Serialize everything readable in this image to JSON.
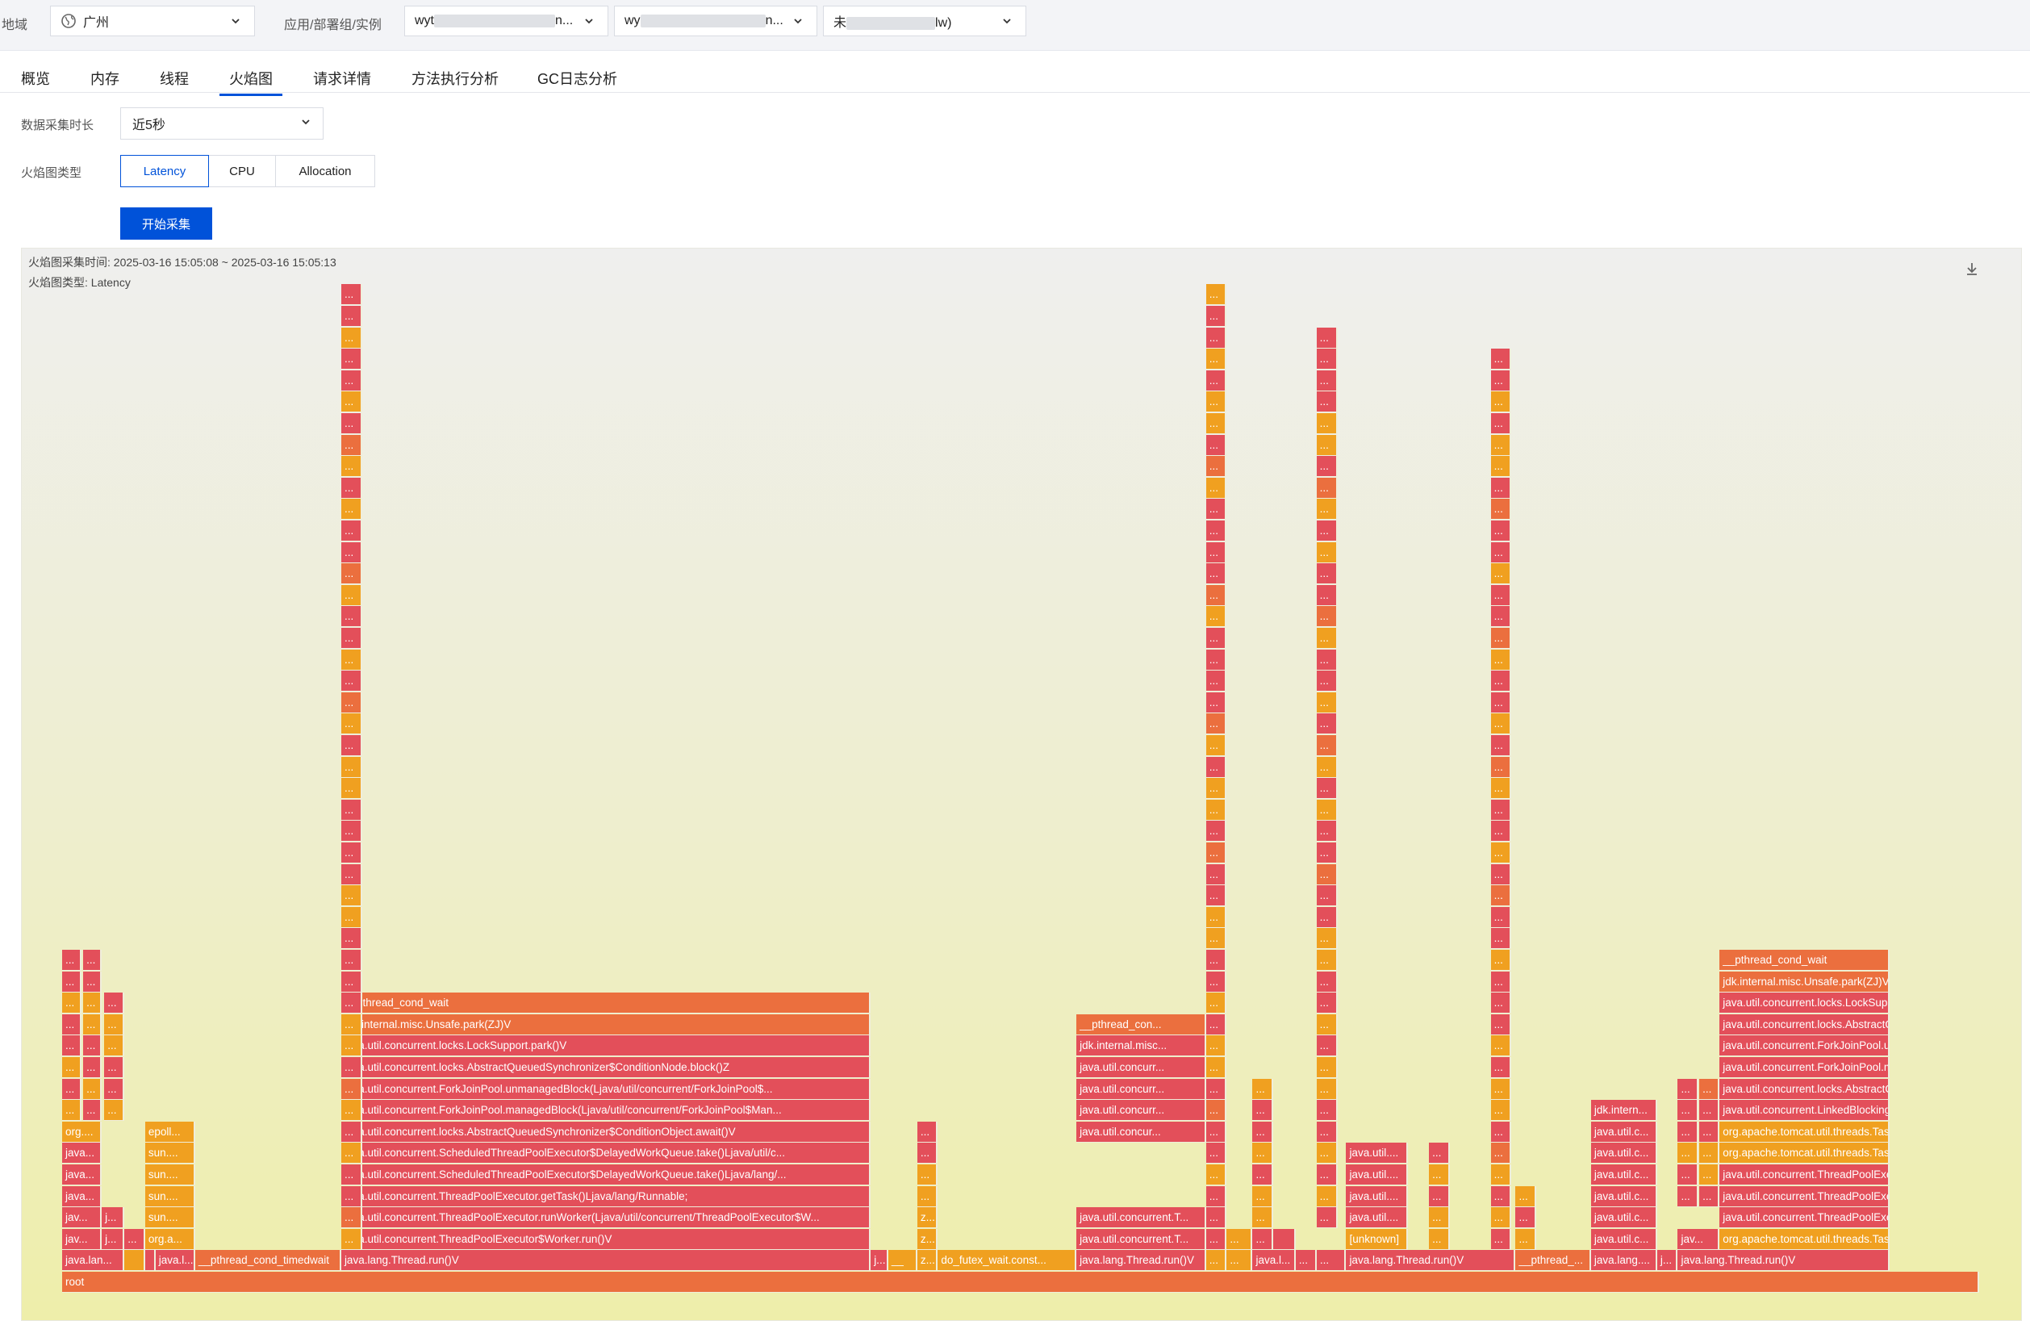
{
  "topbar": {
    "region_label": "地域",
    "region_value": "广州",
    "app_label": "应用/部署组/实例",
    "app_value_prefix": "wyt",
    "app_value_suffix": "n...",
    "group_value_prefix": "wy",
    "group_value_suffix": "n...",
    "instance_value_prefix": "未",
    "instance_value_suffix": "lw)"
  },
  "tabs": [
    "概览",
    "内存",
    "线程",
    "火焰图",
    "请求详情",
    "方法执行分析",
    "GC日志分析"
  ],
  "active_tab": "火焰图",
  "form": {
    "duration_label": "数据采集时长",
    "duration_value": "近5秒",
    "type_label": "火焰图类型",
    "type_options": [
      "Latency",
      "CPU",
      "Allocation"
    ],
    "type_selected": "Latency",
    "start_button": "开始采集"
  },
  "flamegraph": {
    "time_label": "火焰图采集时间:",
    "time_range": "2025-03-16 15:05:08 ~ 2025-03-16 15:05:13",
    "type_label": "火焰图类型:",
    "type_value": "Latency",
    "root": "root",
    "colors": {
      "red": "#e34f5a",
      "orange": "#eb6f3e",
      "amber": "#f0a020"
    },
    "frames": [
      {
        "label": "root",
        "c": "orange",
        "d": 0,
        "s": 0,
        "e": 1.0
      },
      {
        "label": "java.lan...",
        "c": "red",
        "d": 1,
        "s": 0.0,
        "e": 0.0325
      },
      {
        "label": "",
        "c": "amber",
        "d": 1,
        "s": 0.0325,
        "e": 0.0433
      },
      {
        "label": "",
        "c": "red",
        "d": 1,
        "s": 0.0433,
        "e": 0.0487
      },
      {
        "label": "java.l...",
        "c": "red",
        "d": 1,
        "s": 0.0487,
        "e": 0.0694
      },
      {
        "label": "__pthread_cond_timedwait",
        "c": "orange",
        "d": 1,
        "s": 0.0694,
        "e": 0.1456
      },
      {
        "label": "java.lang.Thread.run()V",
        "c": "red",
        "d": 1,
        "s": 0.1456,
        "e": 0.4218
      },
      {
        "label": "j...",
        "c": "red",
        "d": 1,
        "s": 0.4218,
        "e": 0.4309
      },
      {
        "label": "__",
        "c": "amber",
        "d": 1,
        "s": 0.4309,
        "e": 0.4461
      },
      {
        "label": "z...",
        "c": "amber",
        "d": 1,
        "s": 0.4461,
        "e": 0.4568
      },
      {
        "label": "do_futex_wait.const...",
        "c": "amber",
        "d": 1,
        "s": 0.4568,
        "e": 0.5291
      },
      {
        "label": "java.lang.Thread.run()V",
        "c": "red",
        "d": 1,
        "s": 0.5291,
        "e": 0.5967
      },
      {
        "label": "...",
        "c": "amber",
        "d": 1,
        "s": 0.5967,
        "e": 0.6075
      },
      {
        "label": "...",
        "c": "amber",
        "d": 1,
        "s": 0.6075,
        "e": 0.621
      },
      {
        "label": "java.l...",
        "c": "red",
        "d": 1,
        "s": 0.621,
        "e": 0.6434
      },
      {
        "label": "...",
        "c": "red",
        "d": 1,
        "s": 0.6434,
        "e": 0.6544
      },
      {
        "label": "...",
        "c": "red",
        "d": 1,
        "s": 0.6544,
        "e": 0.6698
      },
      {
        "label": "java.lang.Thread.run()V",
        "c": "red",
        "d": 1,
        "s": 0.6698,
        "e": 0.7582
      },
      {
        "label": "__pthread_...",
        "c": "orange",
        "d": 1,
        "s": 0.7582,
        "e": 0.7975
      },
      {
        "label": "java.lang....",
        "c": "red",
        "d": 1,
        "s": 0.7975,
        "e": 0.832
      },
      {
        "label": "j...",
        "c": "red",
        "d": 1,
        "s": 0.832,
        "e": 0.8428
      },
      {
        "label": "java.lang.Thread.run()V",
        "c": "red",
        "d": 1,
        "s": 0.8428,
        "e": 0.9531
      },
      {
        "label": "jav...",
        "c": "red",
        "d": 2,
        "s": 0.0,
        "e": 0.0207
      },
      {
        "label": "j...",
        "c": "red",
        "d": 2,
        "s": 0.0207,
        "e": 0.0325
      },
      {
        "label": "...",
        "c": "red",
        "d": 2,
        "s": 0.0325,
        "e": 0.0433
      },
      {
        "label": "org.a...",
        "c": "amber",
        "d": 2,
        "s": 0.0433,
        "e": 0.0694
      },
      {
        "label": "java.util.concurrent.ThreadPoolExecutor$Worker.run()V",
        "c": "red",
        "d": 2,
        "s": 0.1456,
        "e": 0.4218
      },
      {
        "label": "z...",
        "c": "amber",
        "d": 2,
        "s": 0.4461,
        "e": 0.4568
      },
      {
        "label": "java.util.concurrent.T...",
        "c": "red",
        "d": 2,
        "s": 0.5291,
        "e": 0.5967
      },
      {
        "label": "...",
        "c": "red",
        "d": 2,
        "s": 0.5967,
        "e": 0.6075
      },
      {
        "label": "...",
        "c": "amber",
        "d": 2,
        "s": 0.6075,
        "e": 0.621
      },
      {
        "label": "...",
        "c": "red",
        "d": 2,
        "s": 0.621,
        "e": 0.6434
      },
      {
        "label": "[unknown]",
        "c": "amber",
        "d": 2,
        "s": 0.6698,
        "e": 0.7022
      },
      {
        "label": "java.util.c...",
        "c": "red",
        "d": 2,
        "s": 0.7975,
        "e": 0.832
      },
      {
        "label": "jav...",
        "c": "red",
        "d": 2,
        "s": 0.8428,
        "e": 0.8646
      },
      {
        "label": "org.apache.tomcat.util.threads.Task...",
        "c": "amber",
        "d": 2,
        "s": 0.8646,
        "e": 0.9531
      },
      {
        "label": "jav...",
        "c": "red",
        "d": 3,
        "s": 0.0,
        "e": 0.0207
      },
      {
        "label": "j...",
        "c": "red",
        "d": 3,
        "s": 0.0207,
        "e": 0.0325
      },
      {
        "label": "sun....",
        "c": "amber",
        "d": 3,
        "s": 0.0433,
        "e": 0.0694
      },
      {
        "label": "java.util.concurrent.ThreadPoolExecutor.runWorker(Ljava/util/concurrent/ThreadPoolExecutor$W...",
        "c": "red",
        "d": 3,
        "s": 0.1456,
        "e": 0.4218
      },
      {
        "label": "z...",
        "c": "amber",
        "d": 3,
        "s": 0.4461,
        "e": 0.4568
      },
      {
        "label": "java.util.concurrent.T...",
        "c": "red",
        "d": 3,
        "s": 0.5291,
        "e": 0.5967
      },
      {
        "label": "java.util....",
        "c": "red",
        "d": 3,
        "s": 0.6698,
        "e": 0.7022
      },
      {
        "label": "java.util.c...",
        "c": "red",
        "d": 3,
        "s": 0.7975,
        "e": 0.832
      },
      {
        "label": "java.util.concurrent.ThreadPoolExe...",
        "c": "red",
        "d": 3,
        "s": 0.8646,
        "e": 0.9531
      },
      {
        "label": "java...",
        "c": "red",
        "d": 4,
        "s": 0.0,
        "e": 0.0207
      },
      {
        "label": "sun....",
        "c": "amber",
        "d": 4,
        "s": 0.0433,
        "e": 0.0694
      },
      {
        "label": "java.util.concurrent.ThreadPoolExecutor.getTask()Ljava/lang/Runnable;",
        "c": "red",
        "d": 4,
        "s": 0.1456,
        "e": 0.4218
      },
      {
        "label": "java.util....",
        "c": "red",
        "d": 4,
        "s": 0.6698,
        "e": 0.7022
      },
      {
        "label": "java.util.c...",
        "c": "red",
        "d": 4,
        "s": 0.7975,
        "e": 0.832
      },
      {
        "label": "java.util.concurrent.ThreadPoolExec...",
        "c": "red",
        "d": 4,
        "s": 0.8646,
        "e": 0.9531
      },
      {
        "label": "java...",
        "c": "red",
        "d": 5,
        "s": 0.0,
        "e": 0.0207
      },
      {
        "label": "sun....",
        "c": "amber",
        "d": 5,
        "s": 0.0433,
        "e": 0.0694
      },
      {
        "label": "java.util.concurrent.ScheduledThreadPoolExecutor$DelayedWorkQueue.take()Ljava/lang/...",
        "c": "red",
        "d": 5,
        "s": 0.1456,
        "e": 0.4218
      },
      {
        "label": "java.util....",
        "c": "red",
        "d": 5,
        "s": 0.6698,
        "e": 0.7022
      },
      {
        "label": "java.util.c...",
        "c": "red",
        "d": 5,
        "s": 0.7975,
        "e": 0.832
      },
      {
        "label": "java.util.concurrent.ThreadPoolExec...",
        "c": "red",
        "d": 5,
        "s": 0.8646,
        "e": 0.9531
      },
      {
        "label": "java...",
        "c": "red",
        "d": 6,
        "s": 0.0,
        "e": 0.0207
      },
      {
        "label": "sun....",
        "c": "amber",
        "d": 6,
        "s": 0.0433,
        "e": 0.0694
      },
      {
        "label": "java.util.concurrent.ScheduledThreadPoolExecutor$DelayedWorkQueue.take()Ljava/util/c...",
        "c": "red",
        "d": 6,
        "s": 0.1456,
        "e": 0.4218
      },
      {
        "label": "java.util....",
        "c": "red",
        "d": 6,
        "s": 0.6698,
        "e": 0.7022
      },
      {
        "label": "java.util.c...",
        "c": "red",
        "d": 6,
        "s": 0.7975,
        "e": 0.832
      },
      {
        "label": "org.apache.tomcat.util.threads.Task...",
        "c": "amber",
        "d": 6,
        "s": 0.8646,
        "e": 0.9531
      },
      {
        "label": "org....",
        "c": "amber",
        "d": 7,
        "s": 0.0,
        "e": 0.0207
      },
      {
        "label": "epoll...",
        "c": "amber",
        "d": 7,
        "s": 0.0433,
        "e": 0.0694
      },
      {
        "label": "java.util.concurrent.locks.AbstractQueuedSynchronizer$ConditionObject.await()V",
        "c": "red",
        "d": 7,
        "s": 0.1456,
        "e": 0.4218
      },
      {
        "label": "java.util.concur...",
        "c": "red",
        "d": 7,
        "s": 0.5291,
        "e": 0.5967
      },
      {
        "label": "java.util.c...",
        "c": "red",
        "d": 7,
        "s": 0.7975,
        "e": 0.832
      },
      {
        "label": "org.apache.tomcat.util.threads.Tas...",
        "c": "amber",
        "d": 7,
        "s": 0.8646,
        "e": 0.9531
      },
      {
        "label": "java.util.concurrent.ForkJoinPool.managedBlock(Ljava/util/concurrent/ForkJoinPool$Man...",
        "c": "red",
        "d": 8,
        "s": 0.1456,
        "e": 0.4218
      },
      {
        "label": "java.util.concurr...",
        "c": "red",
        "d": 8,
        "s": 0.5291,
        "e": 0.5967
      },
      {
        "label": "jdk.intern...",
        "c": "red",
        "d": 8,
        "s": 0.7975,
        "e": 0.832
      },
      {
        "label": "java.util.concurrent.LinkedBlockingQ...",
        "c": "red",
        "d": 8,
        "s": 0.8646,
        "e": 0.9531
      },
      {
        "label": "java.util.concurrent.ForkJoinPool.unmanagedBlock(Ljava/util/concurrent/ForkJoinPool$...",
        "c": "red",
        "d": 9,
        "s": 0.1456,
        "e": 0.4218
      },
      {
        "label": "java.util.concurr...",
        "c": "red",
        "d": 9,
        "s": 0.5291,
        "e": 0.5967
      },
      {
        "label": "java.util.concurrent.locks.AbstractQ...",
        "c": "red",
        "d": 9,
        "s": 0.8646,
        "e": 0.9531
      },
      {
        "label": "java.util.concurrent.locks.AbstractQueuedSynchronizer$ConditionNode.block()Z",
        "c": "red",
        "d": 10,
        "s": 0.1456,
        "e": 0.4218
      },
      {
        "label": "java.util.concurr...",
        "c": "red",
        "d": 10,
        "s": 0.5291,
        "e": 0.5967
      },
      {
        "label": "java.util.concurrent.ForkJoinPool.m...",
        "c": "red",
        "d": 10,
        "s": 0.8646,
        "e": 0.9531
      },
      {
        "label": "java.util.concurrent.locks.LockSupport.park()V",
        "c": "red",
        "d": 11,
        "s": 0.1456,
        "e": 0.4218
      },
      {
        "label": "jdk.internal.misc...",
        "c": "red",
        "d": 11,
        "s": 0.5291,
        "e": 0.5967
      },
      {
        "label": "java.util.concurrent.ForkJoinPool.u...",
        "c": "red",
        "d": 11,
        "s": 0.8646,
        "e": 0.9531
      },
      {
        "label": "jdk.internal.misc.Unsafe.park(ZJ)V",
        "c": "orange",
        "d": 12,
        "s": 0.1456,
        "e": 0.4218
      },
      {
        "label": "__pthread_con...",
        "c": "orange",
        "d": 12,
        "s": 0.5291,
        "e": 0.5967
      },
      {
        "label": "java.util.concurrent.locks.AbstractQ...",
        "c": "red",
        "d": 12,
        "s": 0.8646,
        "e": 0.9531
      },
      {
        "label": "__pthread_cond_wait",
        "c": "orange",
        "d": 13,
        "s": 0.1456,
        "e": 0.4218
      },
      {
        "label": "java.util.concurrent.locks.LockSupp...",
        "c": "red",
        "d": 13,
        "s": 0.8646,
        "e": 0.9531
      },
      {
        "label": "jdk.internal.misc.Unsafe.park(ZJ)V",
        "c": "orange",
        "d": 14,
        "s": 0.8646,
        "e": 0.9531
      },
      {
        "label": "__pthread_cond_wait",
        "c": "orange",
        "d": 15,
        "s": 0.8646,
        "e": 0.9531
      }
    ]
  }
}
